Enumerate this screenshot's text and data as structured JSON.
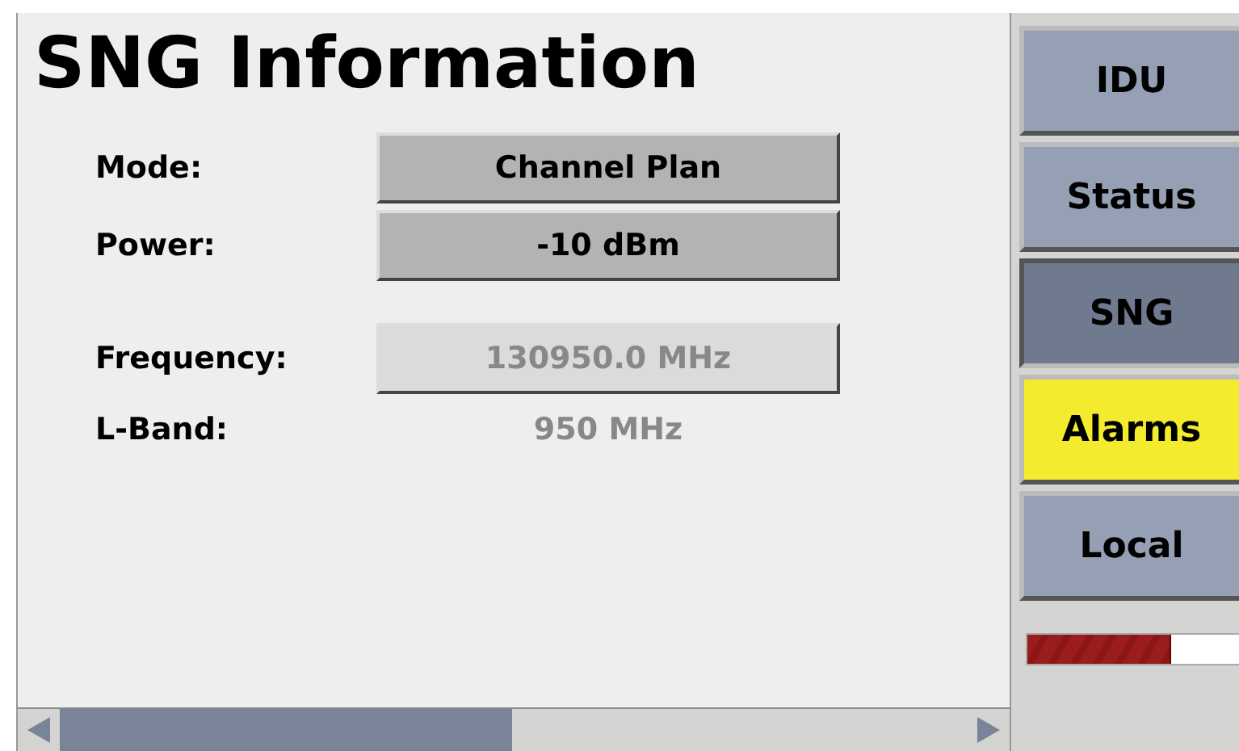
{
  "title": "SNG Information",
  "fields": [
    {
      "label": "Mode:",
      "value": "Channel Plan",
      "kind": "button",
      "disabled": false
    },
    {
      "label": "Power:",
      "value": "-10 dBm",
      "kind": "button",
      "disabled": false
    },
    {
      "label": "Frequency:",
      "value": "130950.0 MHz",
      "kind": "button",
      "disabled": true
    },
    {
      "label": "L-Band:",
      "value": "950 MHz",
      "kind": "text",
      "disabled": true
    }
  ],
  "nav": [
    {
      "label": "IDU",
      "selected": false,
      "alert": false
    },
    {
      "label": "Status",
      "selected": false,
      "alert": false
    },
    {
      "label": "SNG",
      "selected": true,
      "alert": false
    },
    {
      "label": "Alarms",
      "selected": false,
      "alert": true
    },
    {
      "label": "Local",
      "selected": false,
      "alert": false
    }
  ],
  "meter": {
    "level": 0.67
  }
}
